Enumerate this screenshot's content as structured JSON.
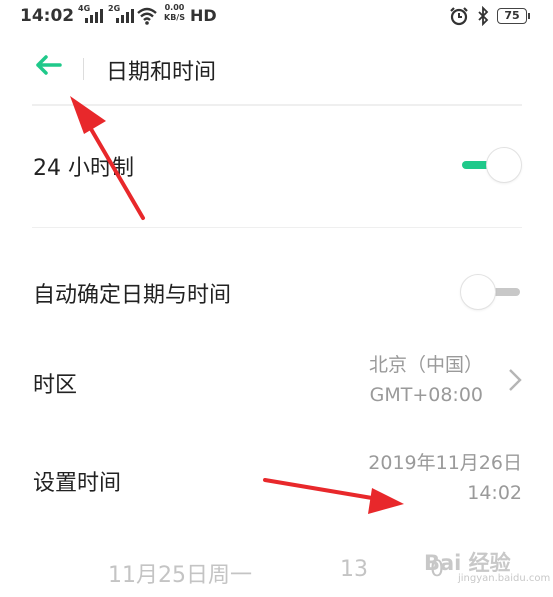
{
  "status_bar": {
    "time": "14:02",
    "signal1_label": "4G",
    "signal2_label": "2G",
    "speed_value": "0.00",
    "speed_unit": "KB/S",
    "hd_label": "HD",
    "battery": "75",
    "icons": [
      "signal-icon",
      "wifi-icon",
      "alarm-icon",
      "bluetooth-icon",
      "battery-icon"
    ]
  },
  "header": {
    "title": "日期和时间",
    "back_icon": "back-arrow-icon"
  },
  "settings": {
    "hour24": {
      "label": "24 小时制",
      "enabled": true
    },
    "auto": {
      "label": "自动确定日期与时间",
      "enabled": false
    },
    "timezone": {
      "label": "时区",
      "value_line1": "北京（中国）",
      "value_line2": "GMT+08:00"
    },
    "set_time": {
      "label": "设置时间",
      "date": "2019年11月26日",
      "time": "14:02"
    }
  },
  "picker": {
    "date": "11月25日周一",
    "hour": "13",
    "minute": "0"
  },
  "watermark": {
    "text": "Bai 经验",
    "url": "jingyan.baidu.com"
  },
  "colors": {
    "accent": "#1fc98a",
    "annotation_arrow": "#e8282b",
    "secondary_text": "#9a9a9a"
  }
}
